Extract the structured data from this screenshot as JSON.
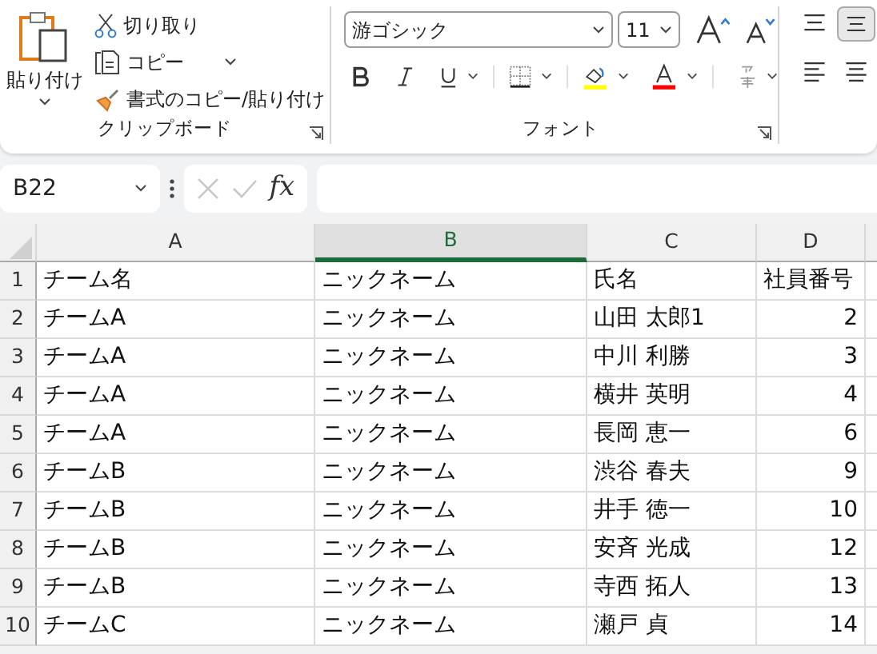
{
  "ribbon": {
    "clipboard": {
      "paste": "貼り付け",
      "cut": "切り取り",
      "copy": "コピー",
      "format_painter": "書式のコピー/貼り付け",
      "label": "クリップボード"
    },
    "font": {
      "font_name": "游ゴシック",
      "font_size": "11",
      "label": "フォント"
    },
    "alignment": [
      {
        "kind": "top",
        "selected": false
      },
      {
        "kind": "middle",
        "selected": true
      },
      {
        "kind": "left",
        "selected": false
      },
      {
        "kind": "center",
        "selected": false
      }
    ]
  },
  "formula_bar": {
    "name_box": "B22",
    "fx": "fx"
  },
  "sheet": {
    "columns": [
      {
        "label": "A",
        "kind": "text",
        "selected": false
      },
      {
        "label": "B",
        "kind": "text",
        "selected": true
      },
      {
        "label": "C",
        "kind": "text",
        "selected": false
      },
      {
        "label": "D",
        "kind": "number",
        "selected": false
      }
    ],
    "rows": [
      {
        "header": "1",
        "kind": "heading",
        "cells": [
          "チーム名",
          "ニックネーム",
          "氏名",
          "社員番号"
        ]
      },
      {
        "header": "2",
        "kind": "data",
        "cells": [
          "チームA",
          "ニックネーム",
          "山田 太郎1",
          "2"
        ]
      },
      {
        "header": "3",
        "kind": "data",
        "cells": [
          "チームA",
          "ニックネーム",
          "中川 利勝",
          "3"
        ]
      },
      {
        "header": "4",
        "kind": "data",
        "cells": [
          "チームA",
          "ニックネーム",
          "横井 英明",
          "4"
        ]
      },
      {
        "header": "5",
        "kind": "data",
        "cells": [
          "チームA",
          "ニックネーム",
          "長岡 恵一",
          "6"
        ]
      },
      {
        "header": "6",
        "kind": "data",
        "cells": [
          "チームB",
          "ニックネーム",
          "渋谷 春夫",
          "9"
        ]
      },
      {
        "header": "7",
        "kind": "data",
        "cells": [
          "チームB",
          "ニックネーム",
          "井手 徳一",
          "10"
        ]
      },
      {
        "header": "8",
        "kind": "data",
        "cells": [
          "チームB",
          "ニックネーム",
          "安斉 光成",
          "12"
        ]
      },
      {
        "header": "9",
        "kind": "data",
        "cells": [
          "チームB",
          "ニックネーム",
          "寺西 拓人",
          "13"
        ]
      },
      {
        "header": "10",
        "kind": "data",
        "cells": [
          "チームC",
          "ニックネーム",
          "瀬戸 貞",
          "14"
        ]
      }
    ]
  }
}
